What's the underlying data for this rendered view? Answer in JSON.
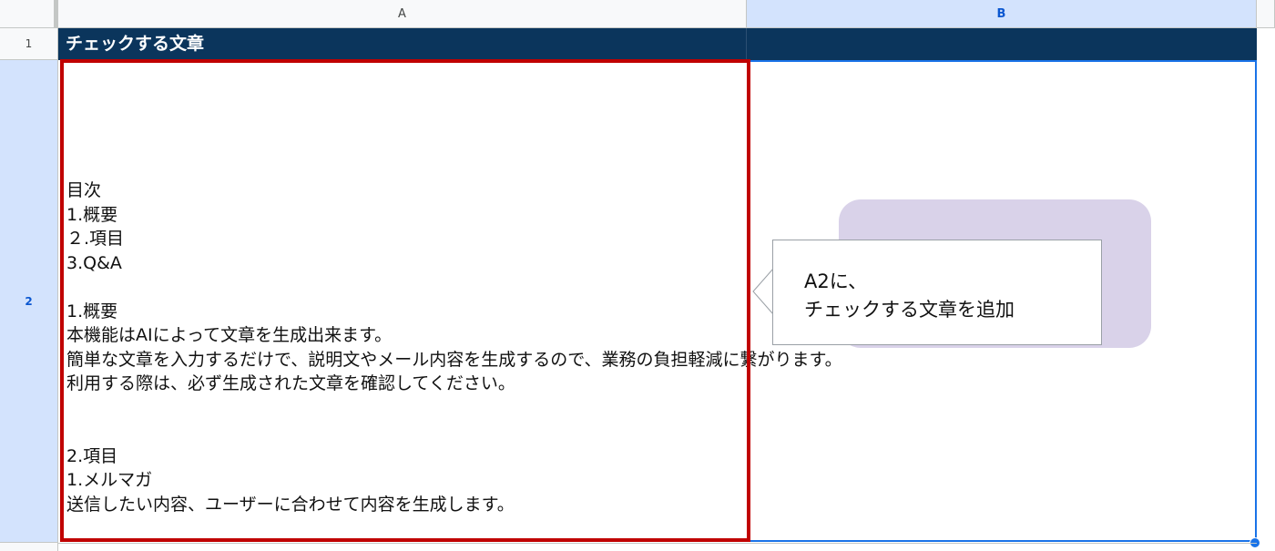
{
  "sheet": {
    "columns": [
      "A",
      "B"
    ],
    "rows": [
      "1",
      "2"
    ]
  },
  "cells": {
    "A1": "チェックする文章",
    "A2": "目次\n1.概要\n２.項目\n3.Q&A\n\n1.概要\n本機能はAIによって文章を生成出来ます。\n簡単な文章を入力するだけで、説明文やメール内容を生成するので、業務の負担軽減に繋がります。\n利用する際は、必ず生成された文章を確認してください。\n\n\n2.項目\n1.メルマガ\n送信したい内容、ユーザーに合わせて内容を生成します。"
  },
  "callout": {
    "text": "A2に、\nチェックする文章を追加"
  },
  "colors": {
    "header_band": "#0b355c",
    "highlight_border": "#c00000",
    "selection": "#1a73e8",
    "callout_shadow": "#d9d2e9"
  }
}
